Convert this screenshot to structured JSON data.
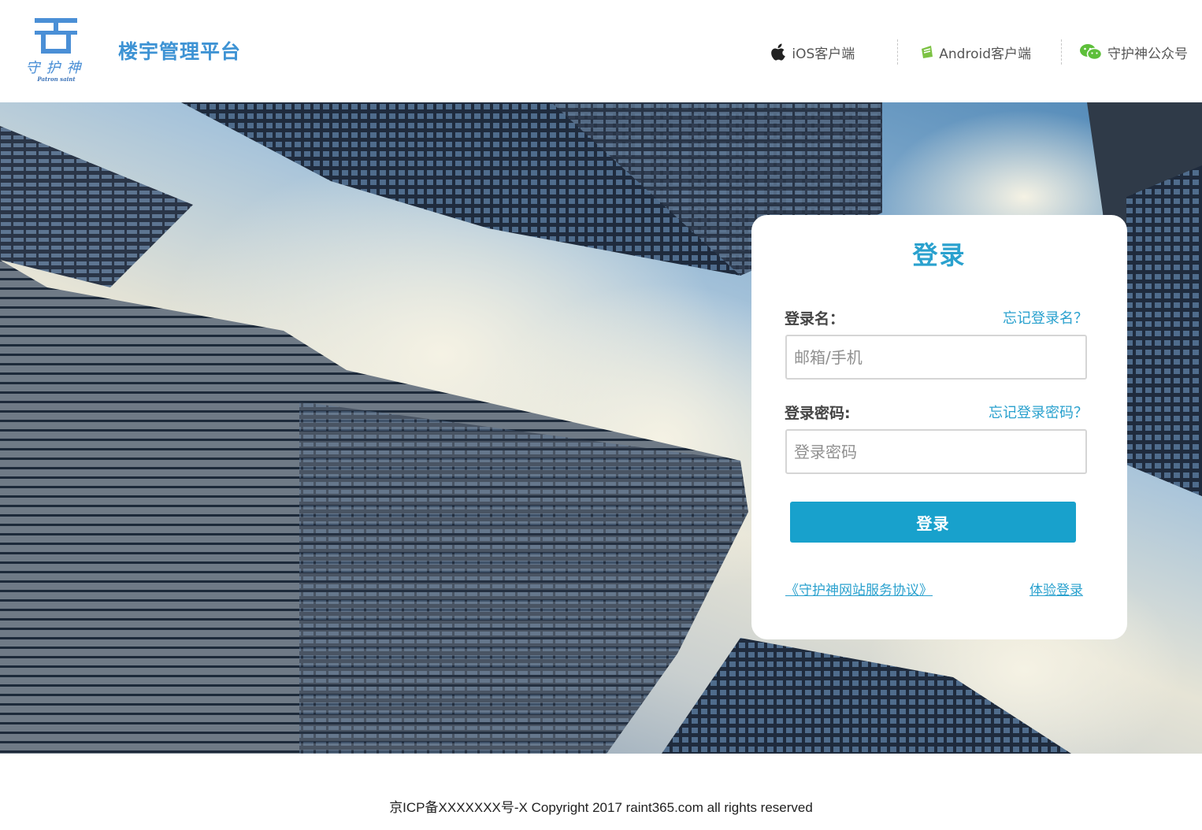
{
  "header": {
    "logo_cn": "守护神",
    "logo_en": "Patron saint",
    "site_title": "楼宇管理平台",
    "links": [
      {
        "label": "iOS客户端",
        "icon": "apple-icon"
      },
      {
        "label": "Android客户端",
        "icon": "android-icon"
      },
      {
        "label": "守护神公众号",
        "icon": "wechat-icon"
      }
    ]
  },
  "login": {
    "title": "登录",
    "username_label": "登录名：",
    "forgot_username": "忘记登录名？",
    "username_placeholder": "邮箱/手机",
    "username_value": "",
    "password_label": "登录密码:",
    "forgot_password": "忘记登录密码？",
    "password_placeholder": "登录密码",
    "password_value": "",
    "submit_label": "登录",
    "agreement_link": "《守护神网站服务协议》",
    "trial_login_link": "体验登录"
  },
  "footer": {
    "copyright": "京ICP备XXXXXXX号-X Copyright 2017 raint365.com all rights reserved"
  },
  "colors": {
    "brand_blue": "#3e93d4",
    "accent": "#2aa1ce",
    "button": "#18a1cc"
  }
}
